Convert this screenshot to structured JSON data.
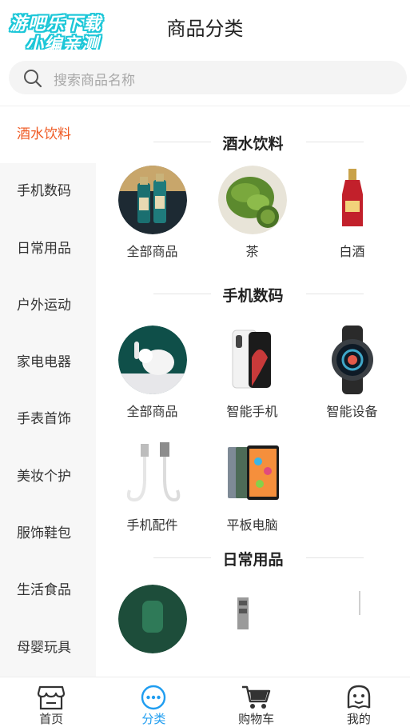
{
  "header": {
    "title": "商品分类",
    "watermark_line1": "游吧乐下载",
    "watermark_line2": "小编亲测"
  },
  "search": {
    "placeholder": "搜索商品名称"
  },
  "sidebar": {
    "active_index": 0,
    "items": [
      {
        "label": "酒水饮料"
      },
      {
        "label": "手机数码"
      },
      {
        "label": "日常用品"
      },
      {
        "label": "户外运动"
      },
      {
        "label": "家电电器"
      },
      {
        "label": "手表首饰"
      },
      {
        "label": "美妆个护"
      },
      {
        "label": "服饰鞋包"
      },
      {
        "label": "生活食品"
      },
      {
        "label": "母婴玩具"
      }
    ]
  },
  "sections": [
    {
      "title": "酒水饮料",
      "items": [
        {
          "label": "全部商品",
          "icon": "liquor-bottles-thumbnail"
        },
        {
          "label": "茶",
          "icon": "tea-leaves-thumbnail"
        },
        {
          "label": "白酒",
          "icon": "baijiu-bottle-thumbnail"
        }
      ]
    },
    {
      "title": "手机数码",
      "items": [
        {
          "label": "全部商品",
          "icon": "earbuds-thumbnail"
        },
        {
          "label": "智能手机",
          "icon": "smartphone-thumbnail"
        },
        {
          "label": "智能设备",
          "icon": "smartwatch-thumbnail"
        },
        {
          "label": "手机配件",
          "icon": "usb-cable-thumbnail"
        },
        {
          "label": "平板电脑",
          "icon": "tablet-thumbnail"
        }
      ]
    },
    {
      "title": "日常用品",
      "items": [
        {
          "label": "",
          "icon": "green-appliance-thumbnail"
        },
        {
          "label": "",
          "icon": "tool-kit-thumbnail"
        },
        {
          "label": "",
          "icon": "white-item-thumbnail"
        }
      ]
    }
  ],
  "tabbar": {
    "active_index": 1,
    "tabs": [
      {
        "label": "首页",
        "icon": "store-icon"
      },
      {
        "label": "分类",
        "icon": "category-dots-icon"
      },
      {
        "label": "购物车",
        "icon": "cart-icon"
      },
      {
        "label": "我的",
        "icon": "profile-face-icon"
      }
    ]
  },
  "colors": {
    "accent_active_sidebar": "#ef5a23",
    "accent_active_tab": "#1f9df0",
    "sidebar_bg": "#f7f7f7"
  }
}
